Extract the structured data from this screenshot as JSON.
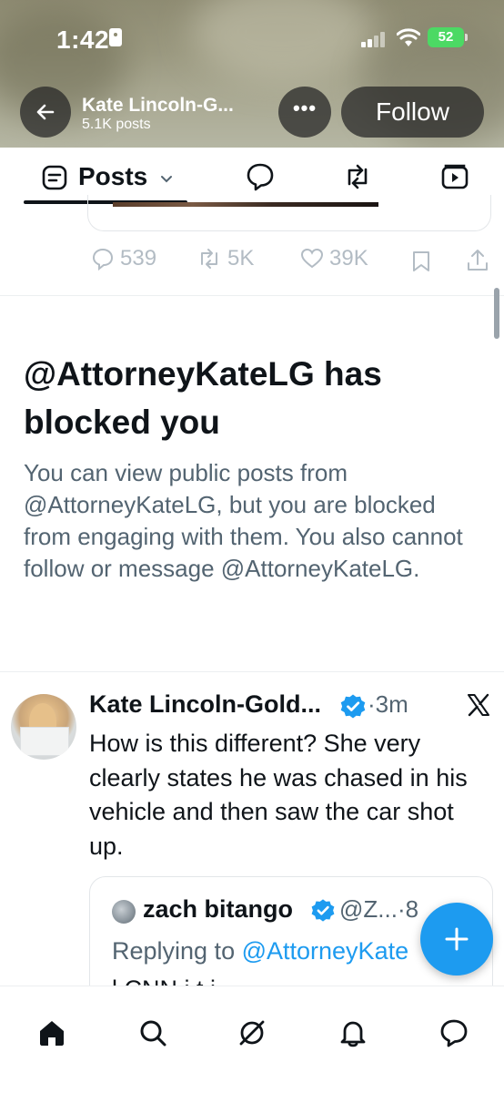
{
  "status_bar": {
    "time": "1:42",
    "battery": "52"
  },
  "header": {
    "profile_name": "Kate Lincoln-G...",
    "post_count": "5.1K posts",
    "more_label": "•••",
    "follow_label": "Follow"
  },
  "tabs": [
    {
      "label": "Posts",
      "icon": "posts-icon",
      "active": true
    },
    {
      "label": "",
      "icon": "replies-icon"
    },
    {
      "label": "",
      "icon": "reposts-icon"
    },
    {
      "label": "",
      "icon": "media-icon"
    }
  ],
  "previous_post": {
    "actions": {
      "replies": "539",
      "reposts": "5K",
      "likes": "39K"
    }
  },
  "blocked_notice": {
    "title": "@AttorneyKateLG has blocked you",
    "description": "You can view public posts from @AttorneyKateLG, but you are blocked from engaging with them. You also cannot follow or message @AttorneyKateLG."
  },
  "tweet": {
    "author_name": "Kate Lincoln-Gold...",
    "time": "·3m",
    "text": "How is this different? She very clearly states he was chased in his vehicle and then saw the car shot up.",
    "quote": {
      "author_name": "zach bitango",
      "handle": "@Z...·8",
      "reply_prefix": "Replying to ",
      "reply_mention": "@AttorneyKate",
      "body_partial": "l       CNN  i t     i"
    }
  },
  "colors": {
    "accent": "#1d9bf0",
    "text": "#0f1419",
    "muted": "#536471"
  }
}
